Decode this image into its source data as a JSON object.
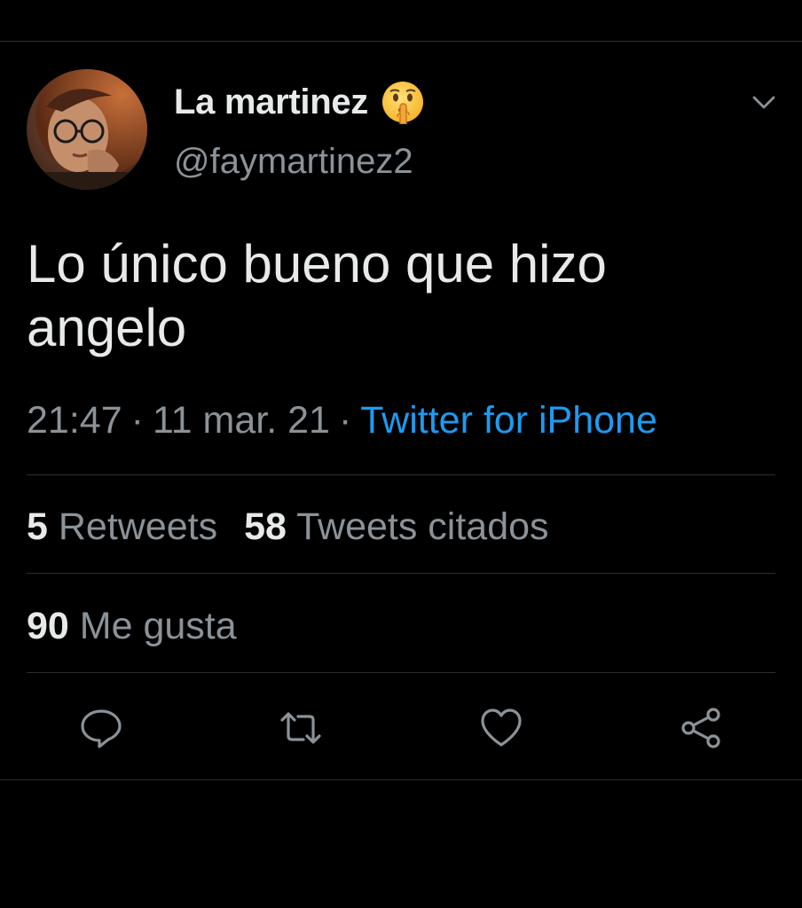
{
  "tweet": {
    "author": {
      "display_name": "La martinez",
      "name_emoji": "shushing-face",
      "handle": "@faymartinez2",
      "avatar": "avatar-photo"
    },
    "text": "Lo único bueno que hizo angelo",
    "time": "21:47",
    "date": "11 mar. 21",
    "separator": "·",
    "source": "Twitter for iPhone"
  },
  "stats": {
    "retweets_count": "5",
    "retweets_label": "Retweets",
    "quotes_count": "58",
    "quotes_label": "Tweets citados",
    "likes_count": "90",
    "likes_label": "Me gusta"
  },
  "actions": [
    {
      "name": "reply",
      "icon": "speech-bubble-icon"
    },
    {
      "name": "retweet",
      "icon": "retweet-icon"
    },
    {
      "name": "like",
      "icon": "heart-icon"
    },
    {
      "name": "share",
      "icon": "share-icon"
    }
  ],
  "colors": {
    "background": "#000000",
    "text_primary": "#e7e9ea",
    "text_secondary": "#8b9298",
    "accent": "#1d9bf0",
    "divider": "#2a2d30"
  }
}
